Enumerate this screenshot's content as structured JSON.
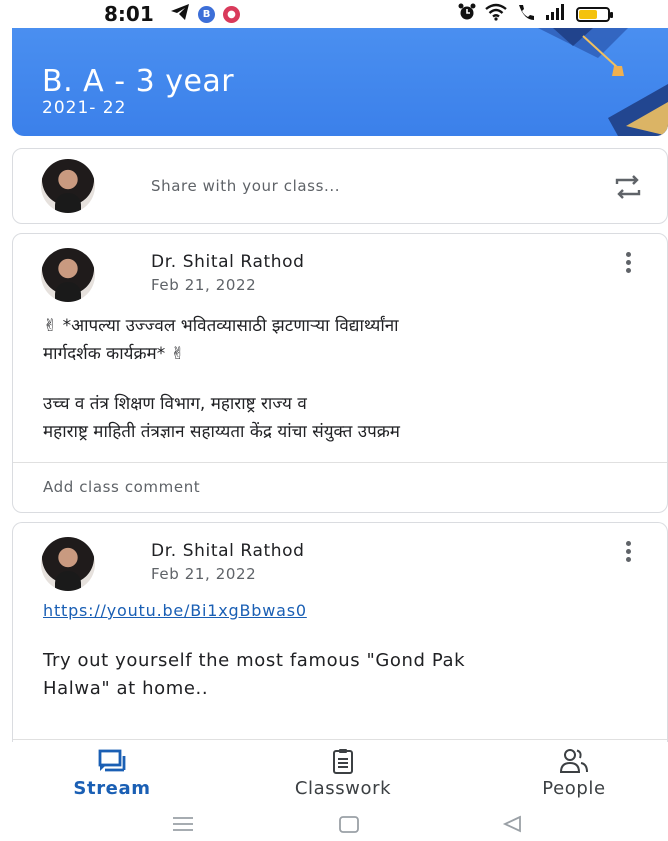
{
  "status_bar": {
    "time": "8:01",
    "left_icons": [
      "telegram-icon",
      "b-badge-icon",
      "location-badge-icon"
    ],
    "right_icons": [
      "alarm-icon",
      "wifi-icon",
      "call-icon",
      "signal-icon",
      "battery-icon"
    ],
    "battery_level": 0.6,
    "colors": {
      "b_badge": "#3d6fd8",
      "location_badge": "#d93a5b",
      "battery_fill": "#f4c20d"
    }
  },
  "header": {
    "title": "B. A - 3 year",
    "subtitle": "2021- 22",
    "background": "#3b80ea",
    "art_icon": "graduation-cap-icon"
  },
  "share": {
    "placeholder": "Share with your class...",
    "icon": "repost-icon"
  },
  "posts": [
    {
      "author": "Dr. Shital Rathod",
      "date": "Feb 21, 2022",
      "lines": [
        "✌ *आपल्या उज्ज्वल भवितव्यासाठी झटणाऱ्या विद्यार्थ्यांना",
        "मार्गदर्शक कार्यक्रम* ✌",
        "उच्च व तंत्र शिक्षण विभाग, महाराष्ट्र राज्य व",
        "महाराष्ट्र माहिती तंत्रज्ञान सहाय्यता केंद्र यांचा संयुक्त उपक्रम"
      ],
      "comment_placeholder": "Add class comment"
    },
    {
      "author": "Dr. Shital Rathod",
      "date": "Feb 21, 2022",
      "link": "https://youtu.be/Bi1xgBbwas0",
      "text_line1": "Try out yourself  the most famous \"Gond Pak",
      "text_line2": "Halwa\" at home.."
    }
  ],
  "bottom_nav": {
    "items": [
      {
        "label": "Stream",
        "icon": "stream-icon",
        "active": true
      },
      {
        "label": "Classwork",
        "icon": "classwork-icon",
        "active": false
      },
      {
        "label": "People",
        "icon": "people-icon",
        "active": false
      }
    ],
    "accent": "#1a5fb4"
  },
  "system_nav": [
    "menu-icon",
    "home-icon",
    "back-icon"
  ]
}
